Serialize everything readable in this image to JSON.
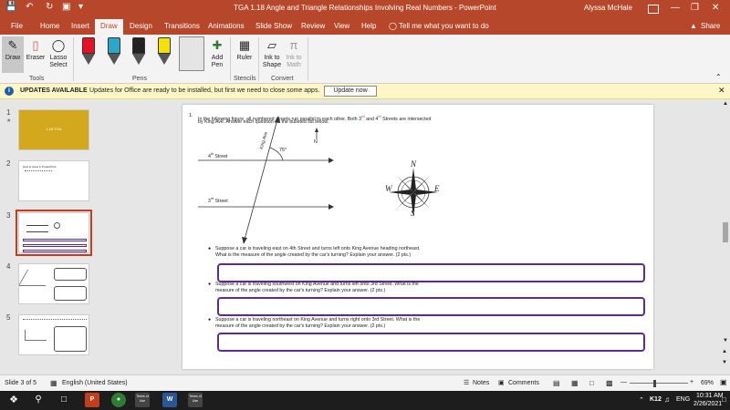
{
  "titlebar": {
    "title": "TGA 1.18 Angle and Triangle Relationships Involving Real Numbers  -  PowerPoint",
    "user": "Alyssa McHale",
    "accent": "#b7472a"
  },
  "tabs": [
    "File",
    "Home",
    "Insert",
    "Draw",
    "Design",
    "Transitions",
    "Animations",
    "Slide Show",
    "Review",
    "View",
    "Help"
  ],
  "tell_me": "Tell me what you want to do",
  "share": "Share",
  "ribbon": {
    "draw": "Draw",
    "eraser": "Eraser",
    "lasso": "Lasso Select",
    "tools_group": "Tools",
    "pens_group": "Pens",
    "add_pen": "Add Pen",
    "ruler": "Ruler",
    "stencils_group": "Stencils",
    "ink_to_shape": "Ink to Shape",
    "ink_to_math": "Ink to Math",
    "convert_group": "Convert",
    "pen_colors": [
      "#e81123",
      "#2aa7c9",
      "#222222",
      "#f5e10a",
      "#111111"
    ]
  },
  "infobar": {
    "title": "UPDATES AVAILABLE",
    "message": "Updates for Office are ready to be installed, but first we need to close some apps.",
    "button": "Update now"
  },
  "thumbnails": [
    {
      "num": "1",
      "title": "1.18 TGA"
    },
    {
      "num": "2",
      "title": "How to show in PowerPoint"
    },
    {
      "num": "3"
    },
    {
      "num": "4"
    },
    {
      "num": "5"
    }
  ],
  "slide": {
    "q_num": "1.",
    "q_line1_a": "In the following figure, all numbered streets run parallel to each other.  Both 3",
    "q_sup1": "rd",
    "q_line1_b": " and 4",
    "q_sup2": "th",
    "q_line1_c": " Streets are intersected",
    "q_line2": "by King Ave.  Answer each question on the bulleted list below.",
    "street4_num": "4",
    "street4_sup": "th",
    "street4_word": "Street",
    "street3_num": "3",
    "street3_sup": "rd",
    "street3_word": "Street",
    "king_ave": "King Ave",
    "angle": "75°",
    "north": "N",
    "compass": {
      "n": "N",
      "s": "S",
      "e": "E",
      "w": "W"
    },
    "bullet1_l1": "Suppose a car is traveling east on 4th Street and turns left onto King Avenue heading northeast.",
    "bullet1_l2": "What is the measure of the angle created by the car's turning?  Explain your answer.  (2 pts.)",
    "bullet2_l1": "Suppose a car is traveling southwest on King Avenue and turns left onto 3rd Street. What is the",
    "bullet2_l2": "measure of the angle created by the car's turning? Explain your answer.  (2 pts.)",
    "bullet3_l1": "Suppose a car is traveling northeast on King Avenue and turns right onto 3rd Street. What is the",
    "bullet3_l2": "measure of the angle created by the car's turning? Explain your answer.  (2 pts.)"
  },
  "status": {
    "slide_of": "Slide 3 of 5",
    "language": "English (United States)",
    "notes": "Notes",
    "comments": "Comments",
    "zoom": "69%"
  },
  "taskbar": {
    "time": "10:31 AM",
    "date": "2/26/2021",
    "lang": "ENG",
    "k12": "K12",
    "app_label": "Terms of Use"
  }
}
